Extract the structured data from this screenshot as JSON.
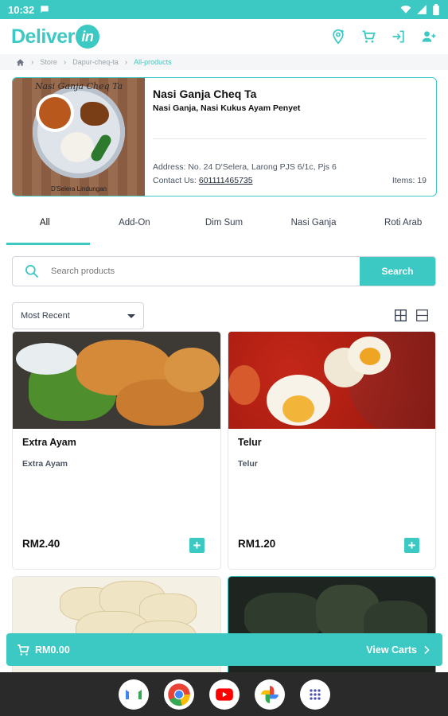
{
  "status_bar": {
    "time": "10:32"
  },
  "app": {
    "logo_text": "Deliver",
    "logo_badge": "in"
  },
  "breadcrumb": {
    "items": [
      "Store",
      "Dapur-cheq-ta",
      "All-products"
    ]
  },
  "store": {
    "sign_text": "Nasi Ganja Cheq Ta",
    "sign_footer": "D'Selera Lindungan",
    "name": "Nasi Ganja Cheq Ta",
    "tagline": "Nasi Ganja, Nasi Kukus Ayam Penyet",
    "address": "Address: No. 24 D'Selera, Larong PJS 6/1c, Pjs 6",
    "contact_label": "Contact Us:",
    "contact_phone": "601111465735",
    "items": "Items: 19"
  },
  "tabs": [
    "All",
    "Add-On",
    "Dim Sum",
    "Nasi Ganja",
    "Roti Arab"
  ],
  "search": {
    "placeholder": "Search products",
    "button": "Search"
  },
  "sort": {
    "selected": "Most Recent"
  },
  "products": [
    {
      "title": "Extra Ayam",
      "subtitle": "Extra Ayam",
      "price": "RM2.40"
    },
    {
      "title": "Telur",
      "subtitle": "Telur",
      "price": "RM1.20"
    }
  ],
  "cart": {
    "amount": "RM0.00",
    "view_label": "View Carts"
  },
  "colors": {
    "accent": "#3cc9c4"
  },
  "icons": [
    "location-icon",
    "cart-icon",
    "login-icon",
    "add-user-icon",
    "home-icon",
    "search-icon",
    "grid-view-icon",
    "list-view-icon",
    "plus-icon",
    "chevron-right-icon"
  ]
}
